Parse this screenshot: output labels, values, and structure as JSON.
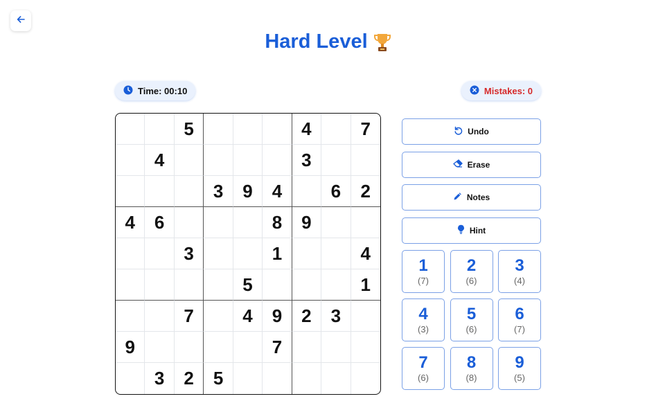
{
  "title": "Hard Level",
  "timer": {
    "label": "Time: 00:10"
  },
  "mistakes": {
    "label": "Mistakes: 0"
  },
  "board": [
    [
      "",
      "",
      "5",
      "",
      "",
      "",
      "4",
      "",
      "7"
    ],
    [
      "",
      "4",
      "",
      "",
      "",
      "",
      "3",
      "",
      ""
    ],
    [
      "",
      "",
      "",
      "3",
      "9",
      "4",
      "",
      "6",
      "2"
    ],
    [
      "4",
      "6",
      "",
      "",
      "",
      "8",
      "9",
      "",
      ""
    ],
    [
      "",
      "",
      "3",
      "",
      "",
      "1",
      "",
      "",
      "4"
    ],
    [
      "",
      "",
      "",
      "",
      "5",
      "",
      "",
      "",
      "1"
    ],
    [
      "",
      "",
      "7",
      "",
      "4",
      "9",
      "2",
      "3",
      ""
    ],
    [
      "9",
      "",
      "",
      "",
      "",
      "7",
      "",
      "",
      ""
    ],
    [
      "",
      "3",
      "2",
      "5",
      "",
      "",
      "",
      "",
      ""
    ]
  ],
  "actions": [
    {
      "label": "Undo",
      "icon": "undo-icon"
    },
    {
      "label": "Erase",
      "icon": "eraser-icon"
    },
    {
      "label": "Notes",
      "icon": "pencil-icon"
    },
    {
      "label": "Hint",
      "icon": "lightbulb-icon"
    }
  ],
  "numpad": [
    {
      "digit": "1",
      "remaining": "(7)"
    },
    {
      "digit": "2",
      "remaining": "(6)"
    },
    {
      "digit": "3",
      "remaining": "(4)"
    },
    {
      "digit": "4",
      "remaining": "(3)"
    },
    {
      "digit": "5",
      "remaining": "(6)"
    },
    {
      "digit": "6",
      "remaining": "(7)"
    },
    {
      "digit": "7",
      "remaining": "(6)"
    },
    {
      "digit": "8",
      "remaining": "(8)"
    },
    {
      "digit": "9",
      "remaining": "(5)"
    }
  ],
  "colors": {
    "accent": "#1a5ed8",
    "error": "#d62a2a",
    "pill_bg": "#eaf1fd"
  }
}
